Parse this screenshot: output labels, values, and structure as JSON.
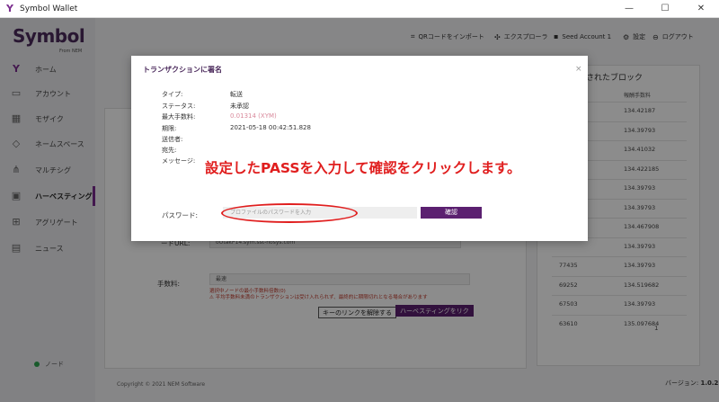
{
  "window": {
    "title": "Symbol Wallet",
    "minimize": "—",
    "maximize": "☐",
    "close": "✕"
  },
  "brand": {
    "name": "Symbol",
    "sub": "From NEM"
  },
  "sidebar": {
    "items": [
      {
        "label": "ホーム",
        "icon": "symbol-icon"
      },
      {
        "label": "アカウント",
        "icon": "account-icon"
      },
      {
        "label": "モザイク",
        "icon": "mosaic-icon"
      },
      {
        "label": "ネームスペース",
        "icon": "tag-icon"
      },
      {
        "label": "マルチシグ",
        "icon": "multisig-icon"
      },
      {
        "label": "ハーベスティング",
        "icon": "harvest-icon"
      },
      {
        "label": "アグリゲート",
        "icon": "aggregate-icon"
      },
      {
        "label": "ニュース",
        "icon": "news-icon"
      }
    ],
    "node_label": "ノード"
  },
  "header": {
    "qr_import": "QRコードをインポート",
    "explorer": "エクスプローラ",
    "account": "Seed Account 1",
    "settings": "設定",
    "logout": "ログアウト"
  },
  "background": {
    "right_title": "されたブロック",
    "col_header": "報酬手数料",
    "rows_right": [
      {
        "left": "",
        "right": "134.42187"
      },
      {
        "left": "",
        "right": "134.39793"
      },
      {
        "left": "",
        "right": "134.41032"
      },
      {
        "left": "",
        "right": "134.422185"
      },
      {
        "left": "",
        "right": "134.39793"
      },
      {
        "left": "",
        "right": "134.39793"
      },
      {
        "left": "",
        "right": "134.467908"
      },
      {
        "left": "",
        "right": "134.39793"
      },
      {
        "left": "77435",
        "right": "134.39793"
      },
      {
        "left": "69252",
        "right": "134.519682"
      },
      {
        "left": "67503",
        "right": "134.39793"
      },
      {
        "left": "63610",
        "right": "135.097684"
      }
    ],
    "pager": "1",
    "node_url_label": "ードURL:",
    "node_url_value": "oOtakP14.sym.sst-hosys.com",
    "fee_label": "手数料:",
    "fee_value": "最速",
    "warn1": "選択中ノードの最小手数料倍数(0)",
    "warn2": "⚠ 平均手数料未満のトランザクションは受け入れられず、最終的に期限切れとなる場合があります",
    "unlink_button": "キーのリンクを解除する",
    "link_button": "ハーベスティングをリク",
    "copyright": "Copyright © 2021 NEM Software",
    "version_label": "バージョン",
    "version": "1.0.2"
  },
  "modal": {
    "title": "トランザクションに署名",
    "close": "×",
    "rows": [
      {
        "key": "タイプ:",
        "value": "転送"
      },
      {
        "key": "ステータス:",
        "value": "未承認"
      },
      {
        "key": "最大手数料:",
        "value": "0.01314 (XYM)"
      },
      {
        "key": "期限:",
        "value": "2021-05-18 00:42:51.828"
      },
      {
        "key": "送信者:",
        "value": ""
      },
      {
        "key": "宛先:",
        "value": ""
      },
      {
        "key": "メッセージ:",
        "value": ""
      }
    ],
    "password_label": "パスワード:",
    "password_placeholder": "プロファイルのパスワードを入力",
    "confirm_button": "確認"
  },
  "annotation": "設定したPASSを入力して確認をクリックします。",
  "colors": {
    "accent": "#5b2070",
    "annotation": "#e01e1e"
  }
}
